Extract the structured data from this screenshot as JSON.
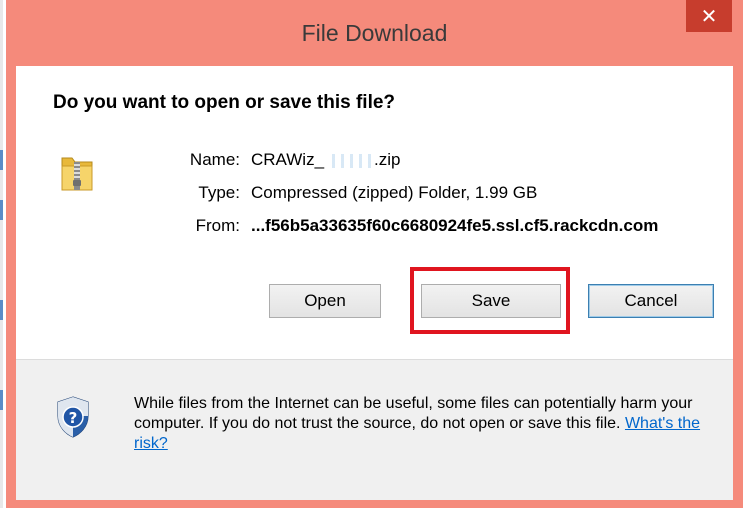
{
  "window": {
    "title": "File Download",
    "close_glyph": "✕"
  },
  "dialog": {
    "question": "Do you want to open or save this file?",
    "file_icon": "zip-folder-icon",
    "name_label": "Name:",
    "name_value_start": "CRAWiz_",
    "name_value_end": ".zip",
    "type_label": "Type:",
    "type_value": "Compressed (zipped) Folder, 1.99 GB",
    "from_label": "From:",
    "from_value": "...f56b5a33635f60c6680924fe5.ssl.cf5.rackcdn.com"
  },
  "buttons": {
    "open": "Open",
    "save": "Save",
    "cancel": "Cancel"
  },
  "footer": {
    "shield_icon": "security-shield-icon",
    "warning_text": "While files from the Internet can be useful, some files can potentially harm your computer. If you do not trust the source, do not open or save this file.",
    "risk_link": "What's the risk?"
  },
  "colors": {
    "title_bar": "#f58a7b",
    "close_button": "#c73d2d",
    "highlight": "#e0151f",
    "link": "#0066cc"
  }
}
